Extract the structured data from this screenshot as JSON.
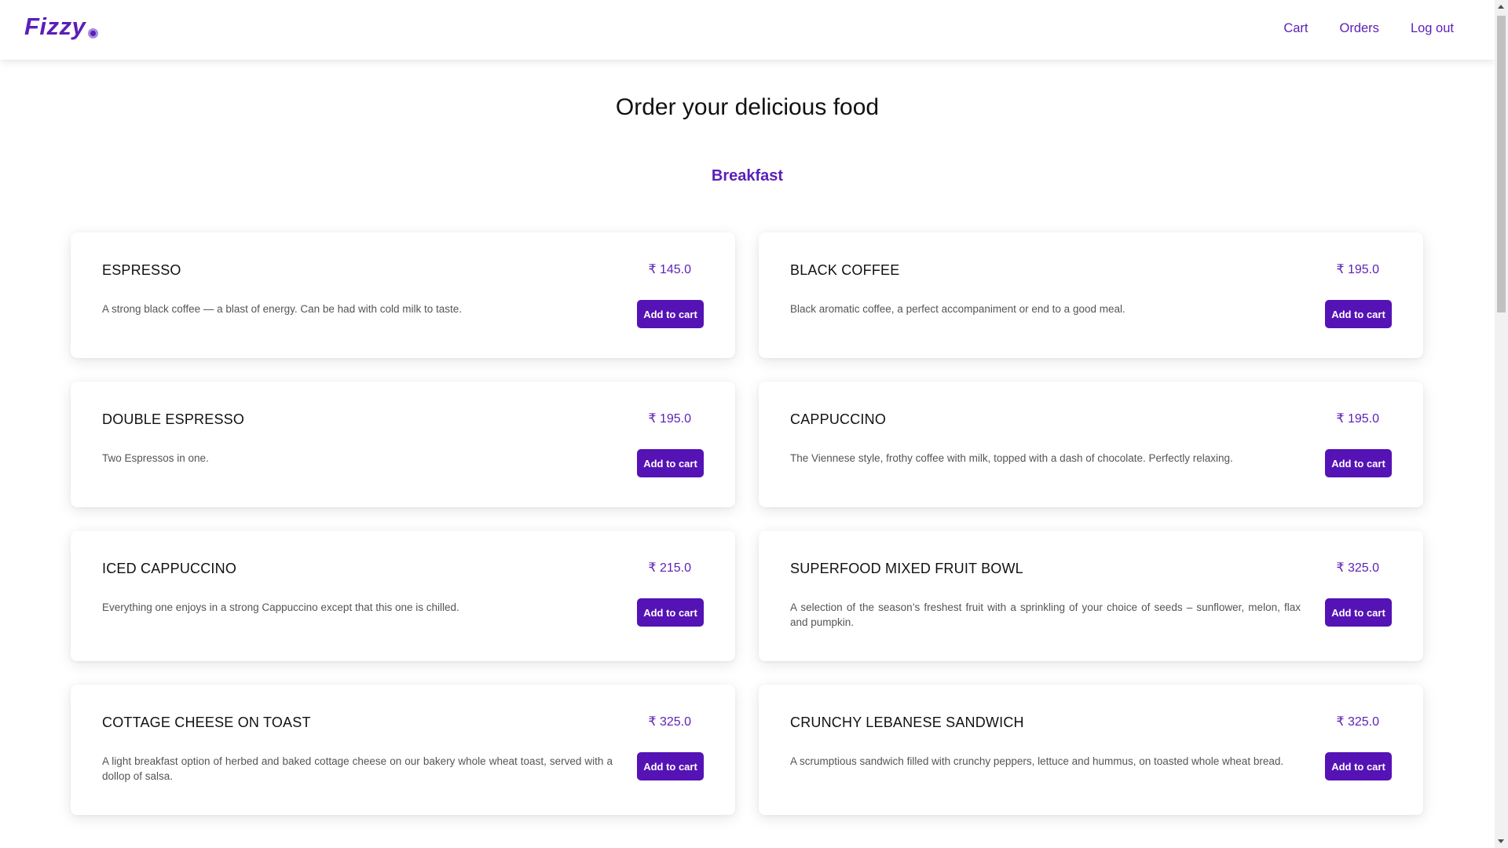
{
  "header": {
    "logo_text": "Fizzy",
    "nav": [
      {
        "label": "Cart"
      },
      {
        "label": "Orders"
      },
      {
        "label": "Log out"
      }
    ]
  },
  "loading_progress": 0.2,
  "main": {
    "title": "Order your delicious food",
    "section_title": "Breakfast",
    "items": [
      {
        "name": "ESPRESSO",
        "price": "₹ 145.0",
        "desc": "A strong black coffee — a blast of energy. Can be had with cold milk to taste.",
        "button": "Add to cart"
      },
      {
        "name": "BLACK COFFEE",
        "price": "₹ 195.0",
        "desc": "Black aromatic coffee, a perfect accompaniment or end to a good meal.",
        "button": "Add to cart"
      },
      {
        "name": "DOUBLE ESPRESSO",
        "price": "₹ 195.0",
        "desc": "Two Espressos in one.",
        "button": "Add to cart"
      },
      {
        "name": "CAPPUCCINO",
        "price": "₹ 195.0",
        "desc": "The Viennese style, frothy coffee with milk, topped with a dash of chocolate. Perfectly relaxing.",
        "button": "Add to cart"
      },
      {
        "name": "ICED CAPPUCCINO",
        "price": "₹ 215.0",
        "desc": "Everything one enjoys in a strong Cappuccino except that this one is chilled.",
        "button": "Add to cart"
      },
      {
        "name": "SUPERFOOD MIXED FRUIT BOWL",
        "price": "₹ 325.0",
        "desc": "A selection of the season’s freshest fruit with a sprinkling of your choice of seeds – sunflower, melon, flax and pumpkin.",
        "button": "Add to cart"
      },
      {
        "name": "COTTAGE CHEESE ON TOAST",
        "price": "₹ 325.0",
        "desc": "A light breakfast option of herbed and baked cottage cheese on our bakery whole wheat toast, served with a dollop of salsa.",
        "button": "Add to cart"
      },
      {
        "name": "CRUNCHY LEBANESE SANDWICH",
        "price": "₹ 325.0",
        "desc": "A scrumptious sandwich filled with crunchy peppers, lettuce and hummus, on toasted whole wheat bread.",
        "button": "Add to cart"
      }
    ]
  },
  "colors": {
    "brand": "#5b1fb8",
    "button": "#5512b5"
  }
}
